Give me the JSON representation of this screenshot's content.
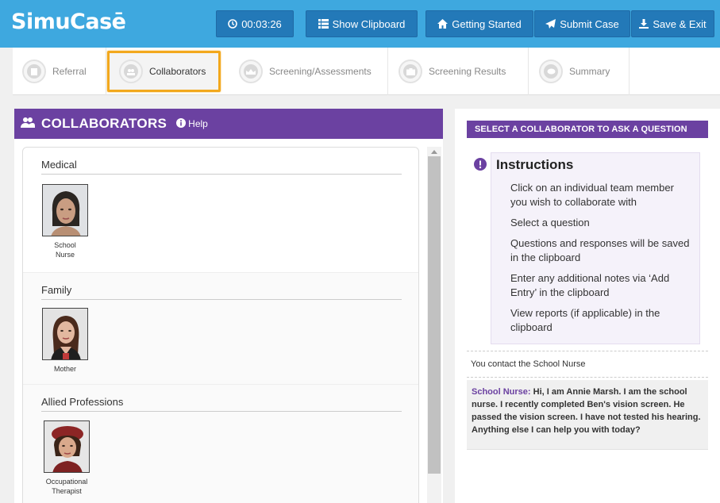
{
  "app": {
    "logo": "SimuCasē"
  },
  "toolbar": {
    "timer": "00:03:26",
    "show_clipboard": "Show Clipboard",
    "getting_started": "Getting Started",
    "submit_case": "Submit Case",
    "save_exit": "Save & Exit"
  },
  "steps": [
    {
      "label": "Referral",
      "active": false
    },
    {
      "label": "Collaborators",
      "active": true
    },
    {
      "label": "Screening/Assessments",
      "active": false
    },
    {
      "label": "Screening Results",
      "active": false
    },
    {
      "label": "Summary",
      "active": false
    }
  ],
  "collaborators_panel": {
    "title": "COLLABORATORS",
    "help": "Help",
    "groups": [
      {
        "title": "Medical",
        "people": [
          {
            "name_line1": "School",
            "name_line2": "Nurse"
          }
        ]
      },
      {
        "title": "Family",
        "people": [
          {
            "name_line1": "Mother",
            "name_line2": ""
          }
        ]
      },
      {
        "title": "Allied Professions",
        "people": [
          {
            "name_line1": "Occupational",
            "name_line2": "Therapist"
          }
        ]
      }
    ]
  },
  "question_panel": {
    "header": "SELECT A COLLABORATOR TO ASK A QUESTION",
    "instructions_title": "Instructions",
    "instructions": [
      "Click on an individual team member you wish to collaborate with",
      "Select a question",
      "Questions and responses will be saved in the clipboard",
      "Enter any additional notes via ‘Add Entry’ in the clipboard",
      "View reports (if applicable) in the clipboard"
    ],
    "contact_line": "You contact the School Nurse",
    "response_speaker": "School Nurse:",
    "response_text": "Hi, I am Annie Marsh. I am the school nurse. I recently completed Ben's vision screen. He passed the vision screen. I have not tested his hearing. Anything else I can help you with today?"
  },
  "colors": {
    "topbar": "#3ea8df",
    "button": "#2379b8",
    "purple": "#6b41a1",
    "active_step_border": "#f2a81d"
  },
  "icons": [
    "clock-icon",
    "clipboard-icon",
    "home-icon",
    "send-icon",
    "download-icon",
    "users-icon",
    "info-icon",
    "alert-icon"
  ]
}
